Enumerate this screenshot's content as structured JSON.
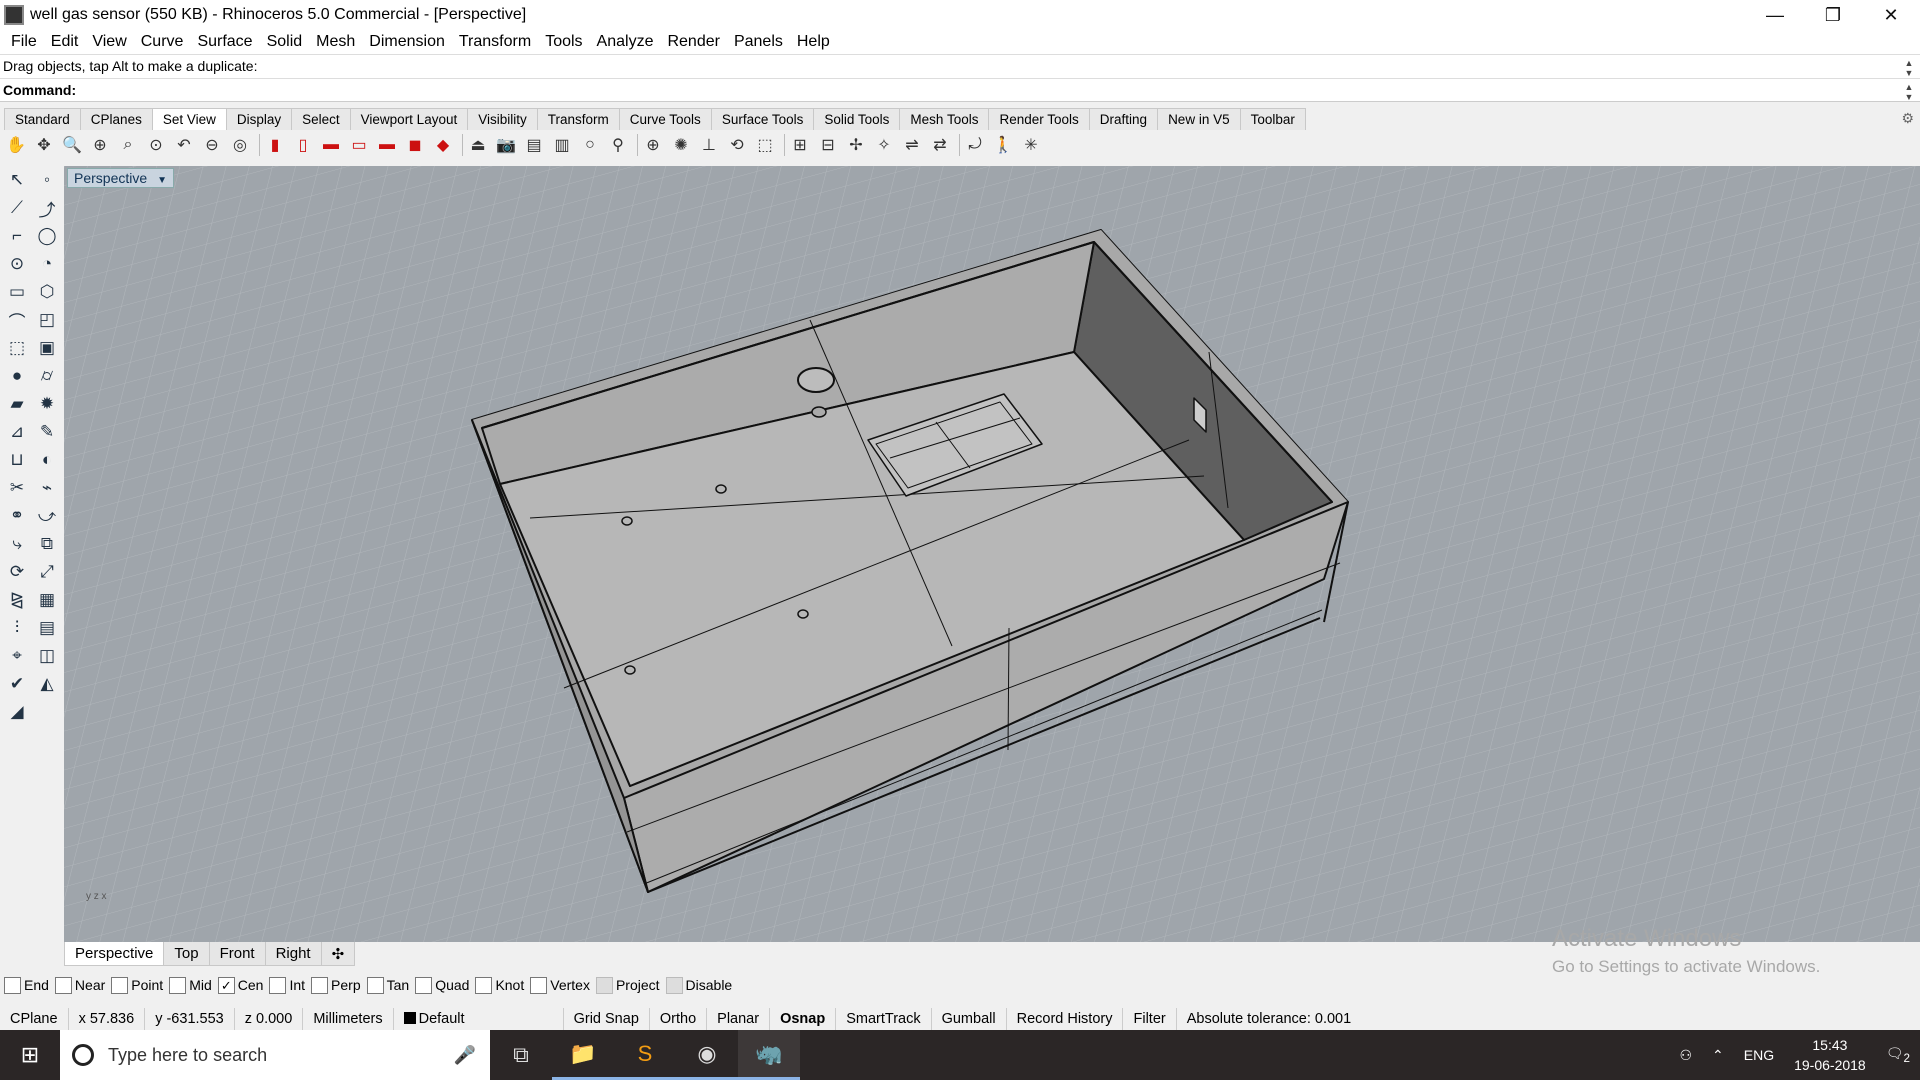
{
  "window": {
    "title": "well gas sensor (550 KB) - Rhinoceros 5.0 Commercial - [Perspective]",
    "controls": [
      "—",
      "❐",
      "✕"
    ]
  },
  "menu": [
    "File",
    "Edit",
    "View",
    "Curve",
    "Surface",
    "Solid",
    "Mesh",
    "Dimension",
    "Transform",
    "Tools",
    "Analyze",
    "Render",
    "Panels",
    "Help"
  ],
  "command": {
    "history": "Drag objects, tap Alt to make a duplicate:",
    "label": "Command:",
    "value": ""
  },
  "toolbar_tabs": {
    "items": [
      "Standard",
      "CPlanes",
      "Set View",
      "Display",
      "Select",
      "Viewport Layout",
      "Visibility",
      "Transform",
      "Curve Tools",
      "Surface Tools",
      "Solid Tools",
      "Mesh Tools",
      "Render Tools",
      "Drafting",
      "New in V5",
      "Toolbar"
    ],
    "active": "Set View"
  },
  "viewport": {
    "label": "Perspective",
    "axis_label": "y z x"
  },
  "view_tabs": {
    "items": [
      "Perspective",
      "Top",
      "Front",
      "Right",
      "✣"
    ],
    "active": "Perspective"
  },
  "osnaps": [
    {
      "label": "End",
      "checked": false
    },
    {
      "label": "Near",
      "checked": false
    },
    {
      "label": "Point",
      "checked": false
    },
    {
      "label": "Mid",
      "checked": false
    },
    {
      "label": "Cen",
      "checked": true
    },
    {
      "label": "Int",
      "checked": false
    },
    {
      "label": "Perp",
      "checked": false
    },
    {
      "label": "Tan",
      "checked": false
    },
    {
      "label": "Quad",
      "checked": false
    },
    {
      "label": "Knot",
      "checked": false
    },
    {
      "label": "Vertex",
      "checked": false
    },
    {
      "label": "Project",
      "checked": false,
      "disabled": true
    },
    {
      "label": "Disable",
      "checked": false,
      "disabled": true
    }
  ],
  "status": {
    "cplane": "CPlane",
    "x": "x 57.836",
    "y": "y -631.553",
    "z": "z 0.000",
    "units": "Millimeters",
    "layer": "Default",
    "grid_snap": "Grid Snap",
    "ortho": "Ortho",
    "planar": "Planar",
    "osnap": "Osnap",
    "smarttrack": "SmartTrack",
    "gumball": "Gumball",
    "record_history": "Record History",
    "filter": "Filter",
    "tolerance": "Absolute tolerance: 0.001"
  },
  "watermark": {
    "line1": "Activate Windows",
    "line2": "Go to Settings to activate Windows."
  },
  "taskbar": {
    "search_placeholder": "Type here to search",
    "lang": "ENG",
    "time": "15:43",
    "date": "19-06-2018",
    "notifications": "2"
  }
}
